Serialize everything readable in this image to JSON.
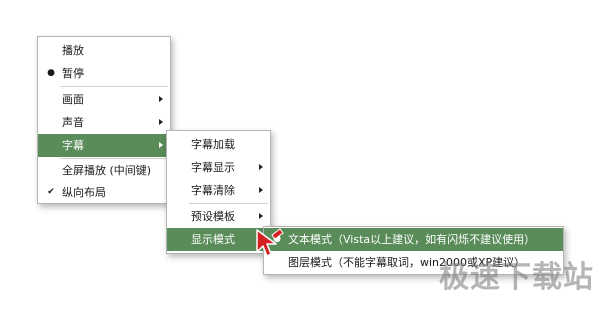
{
  "menu_main": {
    "items": [
      {
        "label": "播放",
        "mark": ""
      },
      {
        "label": "暂停",
        "mark": "●"
      },
      {
        "label": "画面",
        "mark": "",
        "submenu": true
      },
      {
        "label": "声音",
        "mark": "",
        "submenu": true
      },
      {
        "label": "字幕",
        "mark": "",
        "submenu": true,
        "active": true
      },
      {
        "label": "全屏播放 (中间键)",
        "mark": ""
      },
      {
        "label": "纵向布局",
        "mark": "✔"
      }
    ]
  },
  "menu_subtitle": {
    "items": [
      {
        "label": "字幕加载"
      },
      {
        "label": "字幕显示",
        "submenu": true
      },
      {
        "label": "字幕清除",
        "submenu": true
      },
      {
        "label": "预设模板",
        "submenu": true
      },
      {
        "label": "显示模式",
        "submenu": true,
        "active": true
      }
    ]
  },
  "menu_display_mode": {
    "items": [
      {
        "label": "文本模式（Vista以上建议，如有闪烁不建议使用）",
        "mark": "●",
        "active": true
      },
      {
        "label": "图层模式（不能字幕取词，win2000或XP建议）",
        "mark": ""
      }
    ]
  },
  "colors": {
    "highlight": "#5a8c5a",
    "cursor": "#d42020"
  },
  "icons": {
    "cursor": "mouse-pointer-icon"
  },
  "watermark": "极速下载站"
}
